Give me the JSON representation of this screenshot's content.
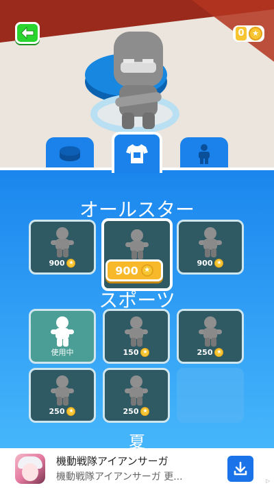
{
  "topbar": {
    "back_icon": "back-arrow-icon",
    "coin_count": "0",
    "coin_icon": "star-coin-icon"
  },
  "tabs": [
    {
      "name": "platform",
      "icon": "platform-disc-icon",
      "active": false
    },
    {
      "name": "outfit",
      "icon": "tshirt-icon",
      "active": true
    },
    {
      "name": "character",
      "icon": "person-icon",
      "active": false
    }
  ],
  "shop": {
    "section1_title": "オールスター",
    "section2_title": "スポーツ",
    "section3_title": "夏",
    "selected_price": "900",
    "allstar_items": [
      {
        "price": "900"
      },
      {
        "price": "900",
        "selected": true
      },
      {
        "price": "900"
      }
    ],
    "sports_items": [
      {
        "status": "使用中",
        "owned": true
      },
      {
        "price": "150"
      },
      {
        "price": "250"
      },
      {
        "price": "250"
      },
      {
        "price": "250"
      },
      {
        "locked": true
      }
    ]
  },
  "ad": {
    "title": "機動戦隊アイアンサーガ",
    "subtitle": "機動戦隊アイアンサーガ 更...",
    "download_icon": "download-icon",
    "mark": "▷"
  },
  "colors": {
    "accent_blue": "#1a82ea",
    "coin_gold": "#f7c531",
    "back_green": "#2ad52f",
    "card_dark": "#2f5a64"
  }
}
